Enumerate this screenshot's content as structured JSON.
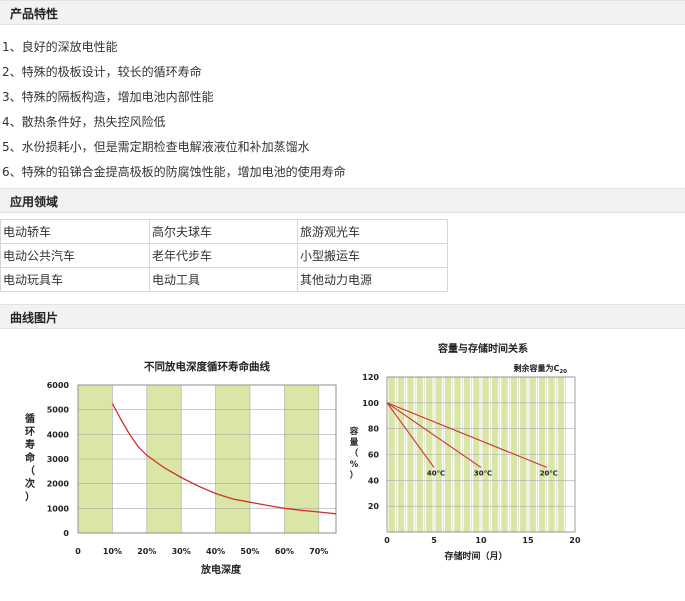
{
  "sections": {
    "features_title": "产品特性",
    "applications_title": "应用领域",
    "curves_title": "曲线图片"
  },
  "features": [
    "1、良好的深放电性能",
    "2、特殊的极板设计，较长的循环寿命",
    "3、特殊的隔板构造，增加电池内部性能",
    "4、散热条件好，热失控风险低",
    "5、水份损耗小，但是需定期检查电解液液位和补加蒸馏水",
    "6、特殊的铅锑合金提高极板的防腐蚀性能，增加电池的使用寿命"
  ],
  "applications": [
    [
      "电动轿车",
      "高尔夫球车",
      "旅游观光车"
    ],
    [
      "电动公共汽车",
      "老年代步车",
      "小型搬运车"
    ],
    [
      "电动玩具车",
      "电动工具",
      "其他动力电源"
    ]
  ],
  "colors": {
    "band_green": "#d9e6a5",
    "curve_red": "#cc3333",
    "grid_line": "#aaaaaa"
  },
  "chart_data": [
    {
      "type": "line",
      "title": "不同放电深度循环寿命曲线",
      "xlabel": "放电深度",
      "ylabel": "循环寿命（次）",
      "xticks": [
        "0",
        "10%",
        "20%",
        "30%",
        "40%",
        "50%",
        "60%",
        "70%"
      ],
      "yticks": [
        "0",
        "1000",
        "2000",
        "3000",
        "4000",
        "5000",
        "6000"
      ],
      "xlim": [
        0,
        75
      ],
      "ylim": [
        0,
        6000
      ],
      "grid": true,
      "series": [
        {
          "x": [
            10,
            12.5,
            15,
            17.5,
            20,
            25,
            30,
            35,
            40,
            45,
            50,
            55,
            60,
            65,
            70,
            75
          ],
          "y": [
            5250,
            4600,
            4000,
            3500,
            3150,
            2650,
            2250,
            1900,
            1600,
            1380,
            1250,
            1120,
            1000,
            920,
            850,
            780
          ]
        }
      ]
    },
    {
      "type": "line",
      "title": "容量与存储时间关系",
      "subtitle": "剩余容量为C",
      "subtitle_sub": "20",
      "xlabel": "存储时间（月）",
      "ylabel": "容量（%）",
      "xticks": [
        "0",
        "5",
        "10",
        "15",
        "20"
      ],
      "yticks": [
        "20",
        "40",
        "60",
        "80",
        "100",
        "120"
      ],
      "xlim": [
        0,
        20
      ],
      "ylim": [
        0,
        120
      ],
      "grid": true,
      "series": [
        {
          "name": "40℃",
          "x": [
            0,
            5
          ],
          "y": [
            100,
            50
          ]
        },
        {
          "name": "30℃",
          "x": [
            0,
            10
          ],
          "y": [
            100,
            50
          ]
        },
        {
          "name": "20℃",
          "x": [
            0,
            17
          ],
          "y": [
            100,
            50
          ]
        }
      ]
    }
  ]
}
